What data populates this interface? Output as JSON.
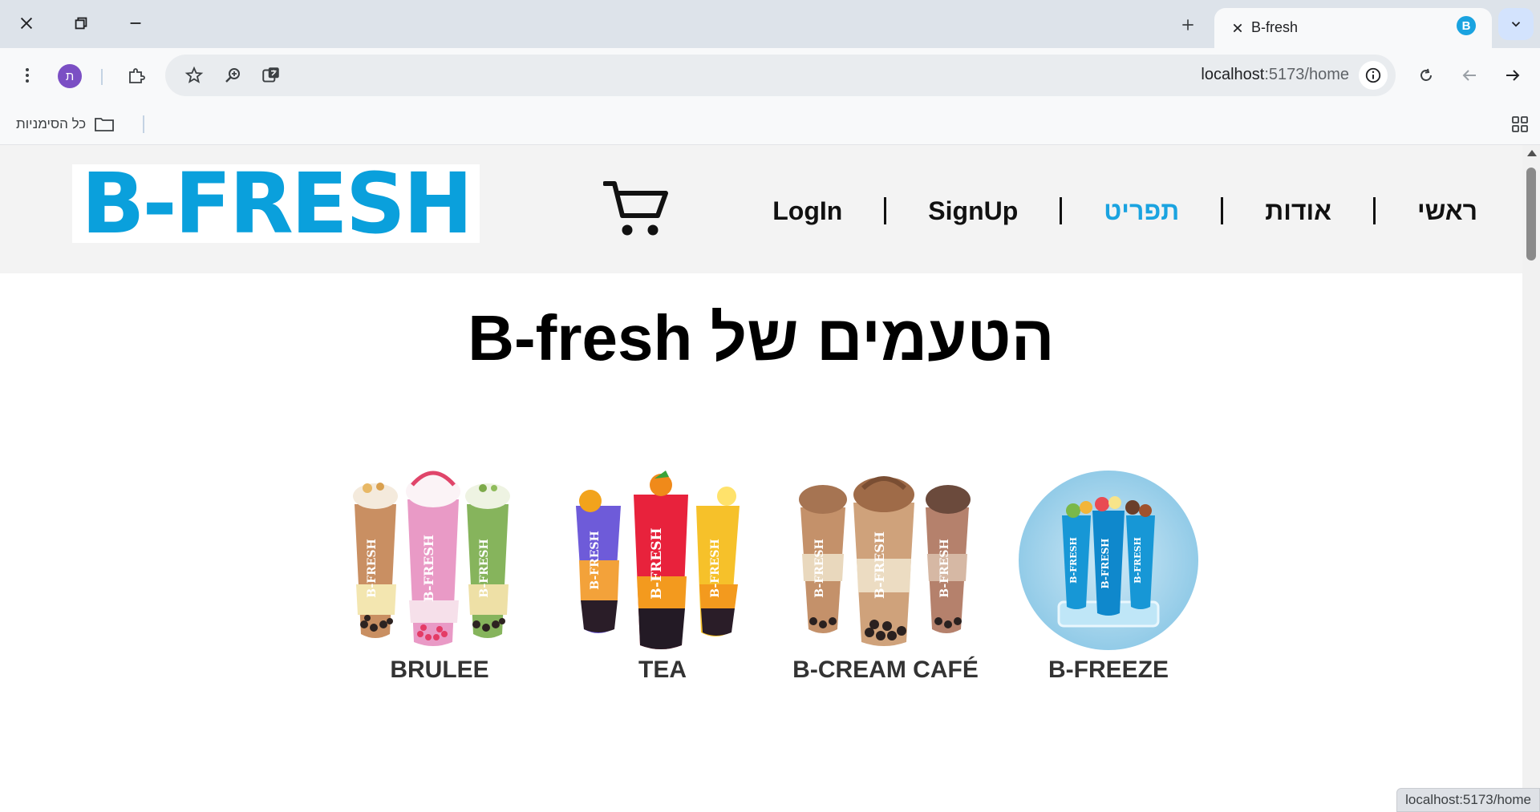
{
  "browser": {
    "tab_title": "B-fresh",
    "tab_favicon_letter": "B",
    "url_host": "localhost",
    "url_path": ":5173/home",
    "profile_initial": "ת",
    "bookmarks_all_label": "כל הסימניות",
    "status_url": "localhost:5173/home"
  },
  "site": {
    "logo_text": "B-FRESH",
    "nav": [
      {
        "label": "ראשי",
        "active": false
      },
      {
        "label": "אודות",
        "active": false
      },
      {
        "label": "תפריט",
        "active": true
      },
      {
        "label": "SignUp",
        "active": false
      },
      {
        "label": "LogIn",
        "active": false
      }
    ],
    "headline": "הטעמים של B-fresh",
    "products": [
      {
        "name": "BRULEE"
      },
      {
        "name": "TEA"
      },
      {
        "name": "B-CREAM CAFÉ"
      },
      {
        "name": "B-FREEZE"
      }
    ],
    "cup_print": "B-FRESH"
  },
  "colors": {
    "brand_blue": "#1aa3e0",
    "logo_blue": "#0aa0dc"
  }
}
